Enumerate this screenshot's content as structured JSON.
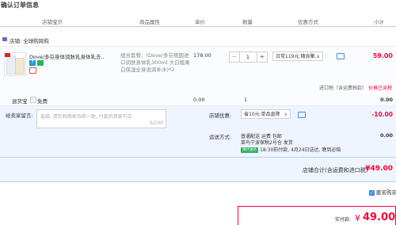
{
  "page_title": "确认订单信息",
  "columns": [
    "店铺宝贝",
    "商品属性",
    "单价",
    "数量",
    "优惠方式",
    "小计"
  ],
  "shop": {
    "icon": "shop-icon",
    "label": "店铺: 全球购跨购"
  },
  "item": {
    "name": "Dove/多芬身体润肤乳身体乳去...",
    "attr": "组合套餐：(Dove/多芬德国进口润肤身体乳300ml 大白瓶果白保湿全身滋润补水)*2",
    "price": "178.00",
    "qty": "1",
    "promo": "日常119元:随肯聚...",
    "subtotal": "59.00",
    "tax_label": "进口税（含运费税款）",
    "tax_link": "价格已含税"
  },
  "return_insurance": {
    "label": "退货宝",
    "option": "免费",
    "price": "0.00",
    "qty": "1",
    "subtotal": "0.00"
  },
  "message": {
    "label": "给卖家留言:",
    "placeholder": "选填, 请先和商家协商一致, 付款后商家可见",
    "counter": "0/200"
  },
  "coupon": {
    "label": "店铺优惠:",
    "value": "省10元:单品直降",
    "amount": "-10.00"
  },
  "delivery": {
    "label": "运送方式:",
    "line1": "普通配送 运费 包邮",
    "line2": "菜鸟宁波保税2号仓  发货",
    "promise_tag": "预计送达",
    "line3": "18:30前付款, 4月24日送达, 晚到必赔",
    "fee": "0.00"
  },
  "shop_total": {
    "label": "店铺合计(含运费和进口税)",
    "value": "¥49.00"
  },
  "anonymous": {
    "label": "匿名购买",
    "checked": true
  },
  "payment": {
    "label": "实付款:",
    "currency": "¥",
    "amount": "49.00"
  },
  "colors": {
    "accent": "#ff0036",
    "blue": "#3b8ff0",
    "panel": "#eef5ff"
  }
}
